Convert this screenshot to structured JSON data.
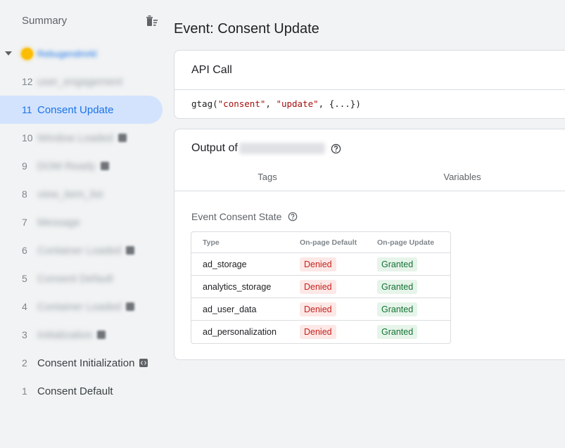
{
  "sidebar": {
    "title": "Summary",
    "page_label": "Rebugendmrkl",
    "events": [
      {
        "num": "12",
        "label": "user_engagement",
        "blurred": true,
        "badge": false,
        "selected": false
      },
      {
        "num": "11",
        "label": "Consent Update",
        "blurred": false,
        "badge": false,
        "selected": true
      },
      {
        "num": "10",
        "label": "Window Loaded",
        "blurred": true,
        "badge": true,
        "selected": false
      },
      {
        "num": "9",
        "label": "DOM Ready",
        "blurred": true,
        "badge": true,
        "selected": false
      },
      {
        "num": "8",
        "label": "view_item_list",
        "blurred": true,
        "badge": false,
        "selected": false
      },
      {
        "num": "7",
        "label": "Message",
        "blurred": true,
        "badge": false,
        "selected": false
      },
      {
        "num": "6",
        "label": "Container Loaded",
        "blurred": true,
        "badge": true,
        "selected": false
      },
      {
        "num": "5",
        "label": "Consent Default",
        "blurred": true,
        "badge": false,
        "selected": false
      },
      {
        "num": "4",
        "label": "Container Loaded",
        "blurred": true,
        "badge": true,
        "selected": false
      },
      {
        "num": "3",
        "label": "Initialization",
        "blurred": true,
        "badge": true,
        "selected": false
      },
      {
        "num": "2",
        "label": "Consent Initialization",
        "blurred": false,
        "badge": true,
        "selected": false
      },
      {
        "num": "1",
        "label": "Consent Default",
        "blurred": false,
        "badge": false,
        "selected": false
      }
    ]
  },
  "main": {
    "title": "Event: Consent Update",
    "api_card": {
      "title": "API Call",
      "code_prefix": "gtag(",
      "code_arg1": "\"consent\"",
      "code_sep": ", ",
      "code_arg2": "\"update\"",
      "code_suffix": ", {...})"
    },
    "output_card": {
      "title_prefix": "Output of",
      "tabs": [
        "Tags",
        "Variables"
      ],
      "consent_title": "Event Consent State",
      "table": {
        "headers": [
          "Type",
          "On-page Default",
          "On-page Update"
        ],
        "rows": [
          {
            "type": "ad_storage",
            "default": "Denied",
            "update": "Granted"
          },
          {
            "type": "analytics_storage",
            "default": "Denied",
            "update": "Granted"
          },
          {
            "type": "ad_user_data",
            "default": "Denied",
            "update": "Granted"
          },
          {
            "type": "ad_personalization",
            "default": "Denied",
            "update": "Granted"
          }
        ]
      }
    }
  },
  "colors": {
    "accent": "#1a73e8",
    "selected_bg": "#d3e3fd",
    "denied_bg": "#fce8e6",
    "denied_text": "#c5221f",
    "granted_bg": "#e6f4ea",
    "granted_text": "#137333"
  }
}
